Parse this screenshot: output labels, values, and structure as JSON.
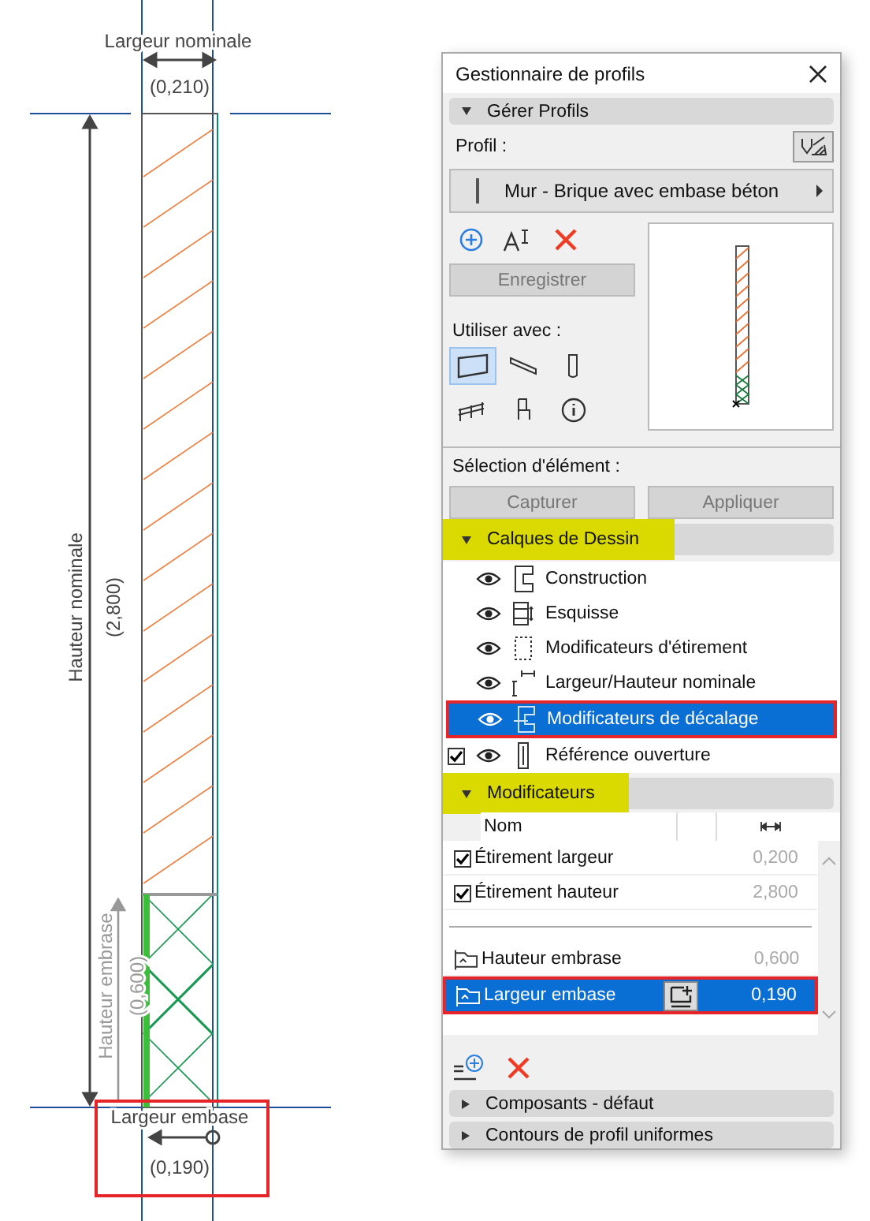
{
  "canvas": {
    "outlined": true,
    "labels": [
      {
        "kind": "width",
        "text": "Largeur nominale"
      },
      {
        "kind": "width_value",
        "text": "(0,210)"
      },
      {
        "kind": "height",
        "text": "Hauteur nominale"
      },
      {
        "kind": "height_value",
        "text": "(2,800)"
      },
      {
        "kind": "base_height",
        "text": "Hauteur embrase"
      },
      {
        "kind": "base_height_value",
        "text": "(0,600)"
      },
      {
        "kind": "base_width",
        "text": "Largeur embase"
      },
      {
        "kind": "base_width_value",
        "text": "(0,190)"
      }
    ]
  },
  "window": {
    "title": "Gestionnaire de profils"
  },
  "manage": {
    "title": "Gérer Profils",
    "expanded": true,
    "highlighted": false,
    "profile_label": "Profil :",
    "profile": "Mur - Brique avec embase béton",
    "save": "Enregistrer",
    "save_disabled": true,
    "use_with_label": "Utiliser avec :",
    "use_with": [
      {
        "kind": "wall",
        "selected": true
      },
      {
        "kind": "beam",
        "selected": false
      },
      {
        "kind": "column",
        "selected": false
      },
      {
        "kind": "railing",
        "selected": false
      },
      {
        "kind": "object",
        "selected": false
      },
      {
        "kind": "info",
        "selected": false
      }
    ],
    "selection_label": "Sélection d'élément :",
    "capture": "Capturer",
    "apply": "Appliquer",
    "buttons_disabled": true
  },
  "layers": {
    "title": "Calques de Dessin",
    "expanded": true,
    "highlighted": true,
    "items": [
      {
        "kind": "construction",
        "label": "Construction",
        "visible": true,
        "selected": false,
        "outlined": false
      },
      {
        "kind": "sketch",
        "label": "Esquisse",
        "visible": true,
        "selected": false,
        "outlined": false
      },
      {
        "kind": "stretch",
        "label": "Modificateurs d'étirement",
        "visible": true,
        "selected": false,
        "outlined": false
      },
      {
        "kind": "nominal",
        "label": "Largeur/Hauteur nominale",
        "visible": true,
        "selected": false,
        "outlined": false
      },
      {
        "kind": "offset",
        "label": "Modificateurs de décalage",
        "visible": true,
        "selected": true,
        "outlined": true
      },
      {
        "kind": "opening",
        "label": "Référence ouverture",
        "visible": true,
        "selected": false,
        "outlined": false,
        "checked": true
      }
    ]
  },
  "modifiers": {
    "title": "Modificateurs",
    "expanded": true,
    "highlighted": true,
    "column_name": "Nom",
    "stretch_rows": [
      {
        "name": "Étirement largeur",
        "value": "0,200",
        "checked": true,
        "selected": false
      },
      {
        "name": "Étirement hauteur",
        "value": "2,800",
        "checked": true,
        "selected": false
      }
    ],
    "offset_rows": [
      {
        "name": "Hauteur embrase",
        "value": "0,600",
        "selected": false,
        "outlined": false
      },
      {
        "name": "Largeur embase",
        "value": "0,190",
        "selected": true,
        "outlined": true
      }
    ]
  },
  "collapsed_sections": [
    {
      "title": "Composants - défaut",
      "expanded": false
    },
    {
      "title": "Contours de profil uniformes",
      "expanded": false
    }
  ]
}
